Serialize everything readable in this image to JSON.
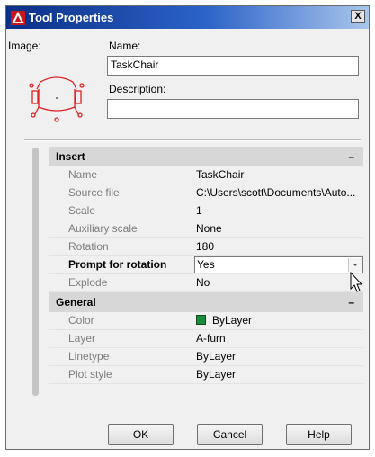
{
  "window": {
    "title": "Tool Properties",
    "close_label": "X"
  },
  "image_label": "Image:",
  "name": {
    "label": "Name:",
    "value": "TaskChair"
  },
  "description": {
    "label": "Description:",
    "value": ""
  },
  "sections": [
    {
      "title": "Insert",
      "collapse": "–",
      "rows": [
        {
          "name": "Name",
          "value": "TaskChair"
        },
        {
          "name": "Source file",
          "value": "C:\\Users\\scott\\Documents\\Auto..."
        },
        {
          "name": "Scale",
          "value": "1"
        },
        {
          "name": "Auxiliary scale",
          "value": "None"
        },
        {
          "name": "Rotation",
          "value": "180"
        },
        {
          "name": "Prompt for rotation",
          "value": "Yes"
        },
        {
          "name": "Explode",
          "value": "No"
        }
      ]
    },
    {
      "title": "General",
      "collapse": "–",
      "rows": [
        {
          "name": "Color",
          "value": "ByLayer"
        },
        {
          "name": "Layer",
          "value": "A-furn"
        },
        {
          "name": "Linetype",
          "value": "ByLayer"
        },
        {
          "name": "Plot style",
          "value": "ByLayer"
        }
      ]
    }
  ],
  "buttons": {
    "ok": "OK",
    "cancel": "Cancel",
    "help": "Help"
  },
  "colors": {
    "title_start": "#0a2f86",
    "color_swatch": "#1d8a3c",
    "preview_red": "#e02020"
  },
  "icons": {
    "app": "autocad-icon",
    "dropdown": "chevron-down-icon",
    "cursor": "pointer-cursor-icon"
  }
}
